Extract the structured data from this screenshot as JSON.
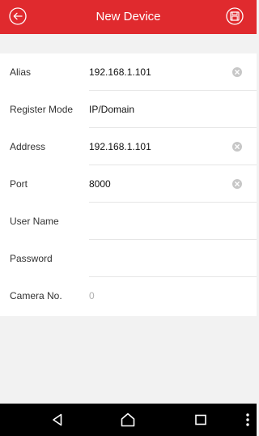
{
  "header": {
    "title": "New Device",
    "back_icon": "back-arrow-circle-icon",
    "save_icon": "save-circle-icon",
    "background_color": "#e02a2e"
  },
  "form": {
    "alias": {
      "label": "Alias",
      "value": "192.168.1.101",
      "clear_icon": "clear-circle-icon"
    },
    "register_mode": {
      "label": "Register Mode",
      "value": "IP/Domain"
    },
    "address": {
      "label": "Address",
      "value": "192.168.1.101",
      "clear_icon": "clear-circle-icon"
    },
    "port": {
      "label": "Port",
      "value": "8000",
      "clear_icon": "clear-circle-icon"
    },
    "user_name": {
      "label": "User Name",
      "value": ""
    },
    "password": {
      "label": "Password",
      "value": ""
    },
    "camera_no": {
      "label": "Camera No.",
      "value": "0"
    }
  },
  "navbar": {
    "icons": [
      "nav-back-icon",
      "nav-home-icon",
      "nav-recent-icon",
      "more-vertical-icon"
    ]
  }
}
